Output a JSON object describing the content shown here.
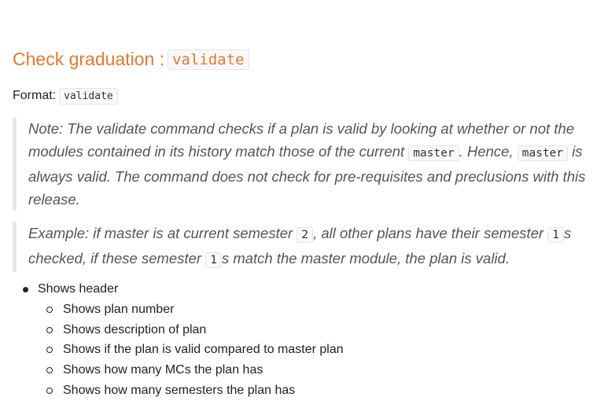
{
  "heading": {
    "text": "Check graduation :",
    "code": "validate"
  },
  "format": {
    "label": "Format:",
    "code": "validate"
  },
  "note": {
    "part1": "Note: The validate command checks if a plan is valid by looking at whether or not the modules contained in its history match those of the current",
    "code1": "master",
    "part2": ". Hence,",
    "code2": "master",
    "part3": "is always valid. The command does not check for pre-requisites and preclusions with this release."
  },
  "example": {
    "part1": "Example: if master is at current semester",
    "code1": "2",
    "part2": ", all other plans have their semester",
    "code2": "1",
    "part3": "s checked, if these semester",
    "code3": "1",
    "part4": "s match the master module, the plan is valid."
  },
  "list": {
    "header": "Shows header",
    "items": [
      "Shows plan number",
      "Shows description of plan",
      "Shows if the plan is valid compared to master plan",
      "Shows how many MCs the plan has",
      "Shows how many semesters the plan has"
    ]
  }
}
